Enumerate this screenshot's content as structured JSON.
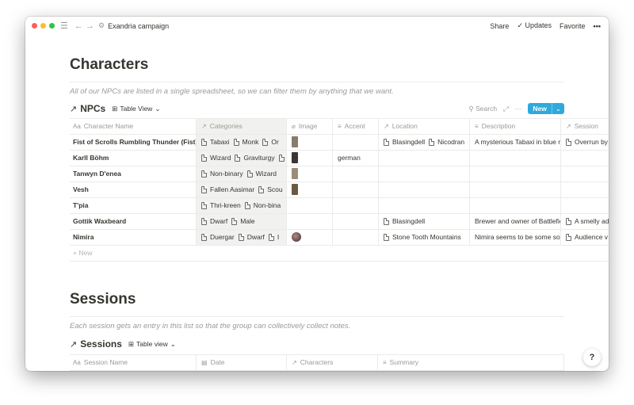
{
  "titlebar": {
    "page_name": "Exandria campaign",
    "share_label": "Share",
    "updates_label": "Updates",
    "favorite_label": "Favorite",
    "more_label": "•••"
  },
  "characters": {
    "heading": "Characters",
    "description": "All of our NPCs are listed in a single spreadsheet, so we can filter them by anything that we want.",
    "db_arrow": "↗",
    "db_title": "NPCs",
    "view_label": "Table View",
    "search_label": "Search",
    "new_label": "New",
    "add_row_label": "+ New",
    "columns": [
      {
        "icon": "Aa",
        "label": "Character Name"
      },
      {
        "icon": "↗",
        "label": "Categories"
      },
      {
        "icon": "⌀",
        "label": "Image"
      },
      {
        "icon": "≡",
        "label": "Accent"
      },
      {
        "icon": "↗",
        "label": "Location"
      },
      {
        "icon": "≡",
        "label": "Description"
      },
      {
        "icon": "↗",
        "label": "Session"
      }
    ],
    "rows": [
      {
        "name": "Fist of Scrolls Rumbling Thunder (Fist)",
        "categories": [
          "Tabaxi",
          "Monk",
          "Or"
        ],
        "image": "thumb-1",
        "accent": "",
        "location": [
          "Blasingdell",
          "Nicodran"
        ],
        "description": "A mysterious Tabaxi in blue ro",
        "session": [
          "Overrun by"
        ]
      },
      {
        "name": "Karll Böhm",
        "categories": [
          "Wizard",
          "Graviturgy",
          ""
        ],
        "image": "thumb-2",
        "accent": "german",
        "location": [],
        "description": "",
        "session": []
      },
      {
        "name": "Tanwyn D'enea",
        "categories": [
          "Non-binary",
          "Wizard"
        ],
        "image": "thumb-3",
        "accent": "",
        "location": [],
        "description": "",
        "session": []
      },
      {
        "name": "Vesh",
        "categories": [
          "Fallen Aasimar",
          "Scou"
        ],
        "image": "thumb-4",
        "accent": "",
        "location": [],
        "description": "",
        "session": []
      },
      {
        "name": "T'pia",
        "categories": [
          "Thri-kreen",
          "Non-bina"
        ],
        "image": "",
        "accent": "",
        "location": [],
        "description": "",
        "session": []
      },
      {
        "name": "Gottik Waxbeard",
        "categories": [
          "Dwarf",
          "Male"
        ],
        "image": "",
        "accent": "",
        "location": [
          "Blasingdell"
        ],
        "description": "Brewer and owner of Battlefie",
        "session": [
          "A smelly ad"
        ]
      },
      {
        "name": "Nimira",
        "categories": [
          "Duergar",
          "Dwarf",
          "I"
        ],
        "image": "avatar",
        "accent": "",
        "location": [
          "Stone Tooth Mountains"
        ],
        "description": "Nimira seems to be some sort",
        "session": [
          "Audience v"
        ]
      }
    ],
    "thumb_colors": [
      "#8a7b6a",
      "#3a3532",
      "#9c8d78",
      "#6b5a43"
    ]
  },
  "sessions": {
    "heading": "Sessions",
    "description": "Each session gets an entry in this list so that the group can collectively collect notes.",
    "db_arrow": "↗",
    "db_title": "Sessions",
    "view_label": "Table view",
    "columns": [
      {
        "icon": "Aa",
        "label": "Session Name"
      },
      {
        "icon": "▤",
        "label": "Date"
      },
      {
        "icon": "↗",
        "label": "Characters"
      },
      {
        "icon": "≡",
        "label": "Summary"
      }
    ]
  },
  "help_label": "?"
}
